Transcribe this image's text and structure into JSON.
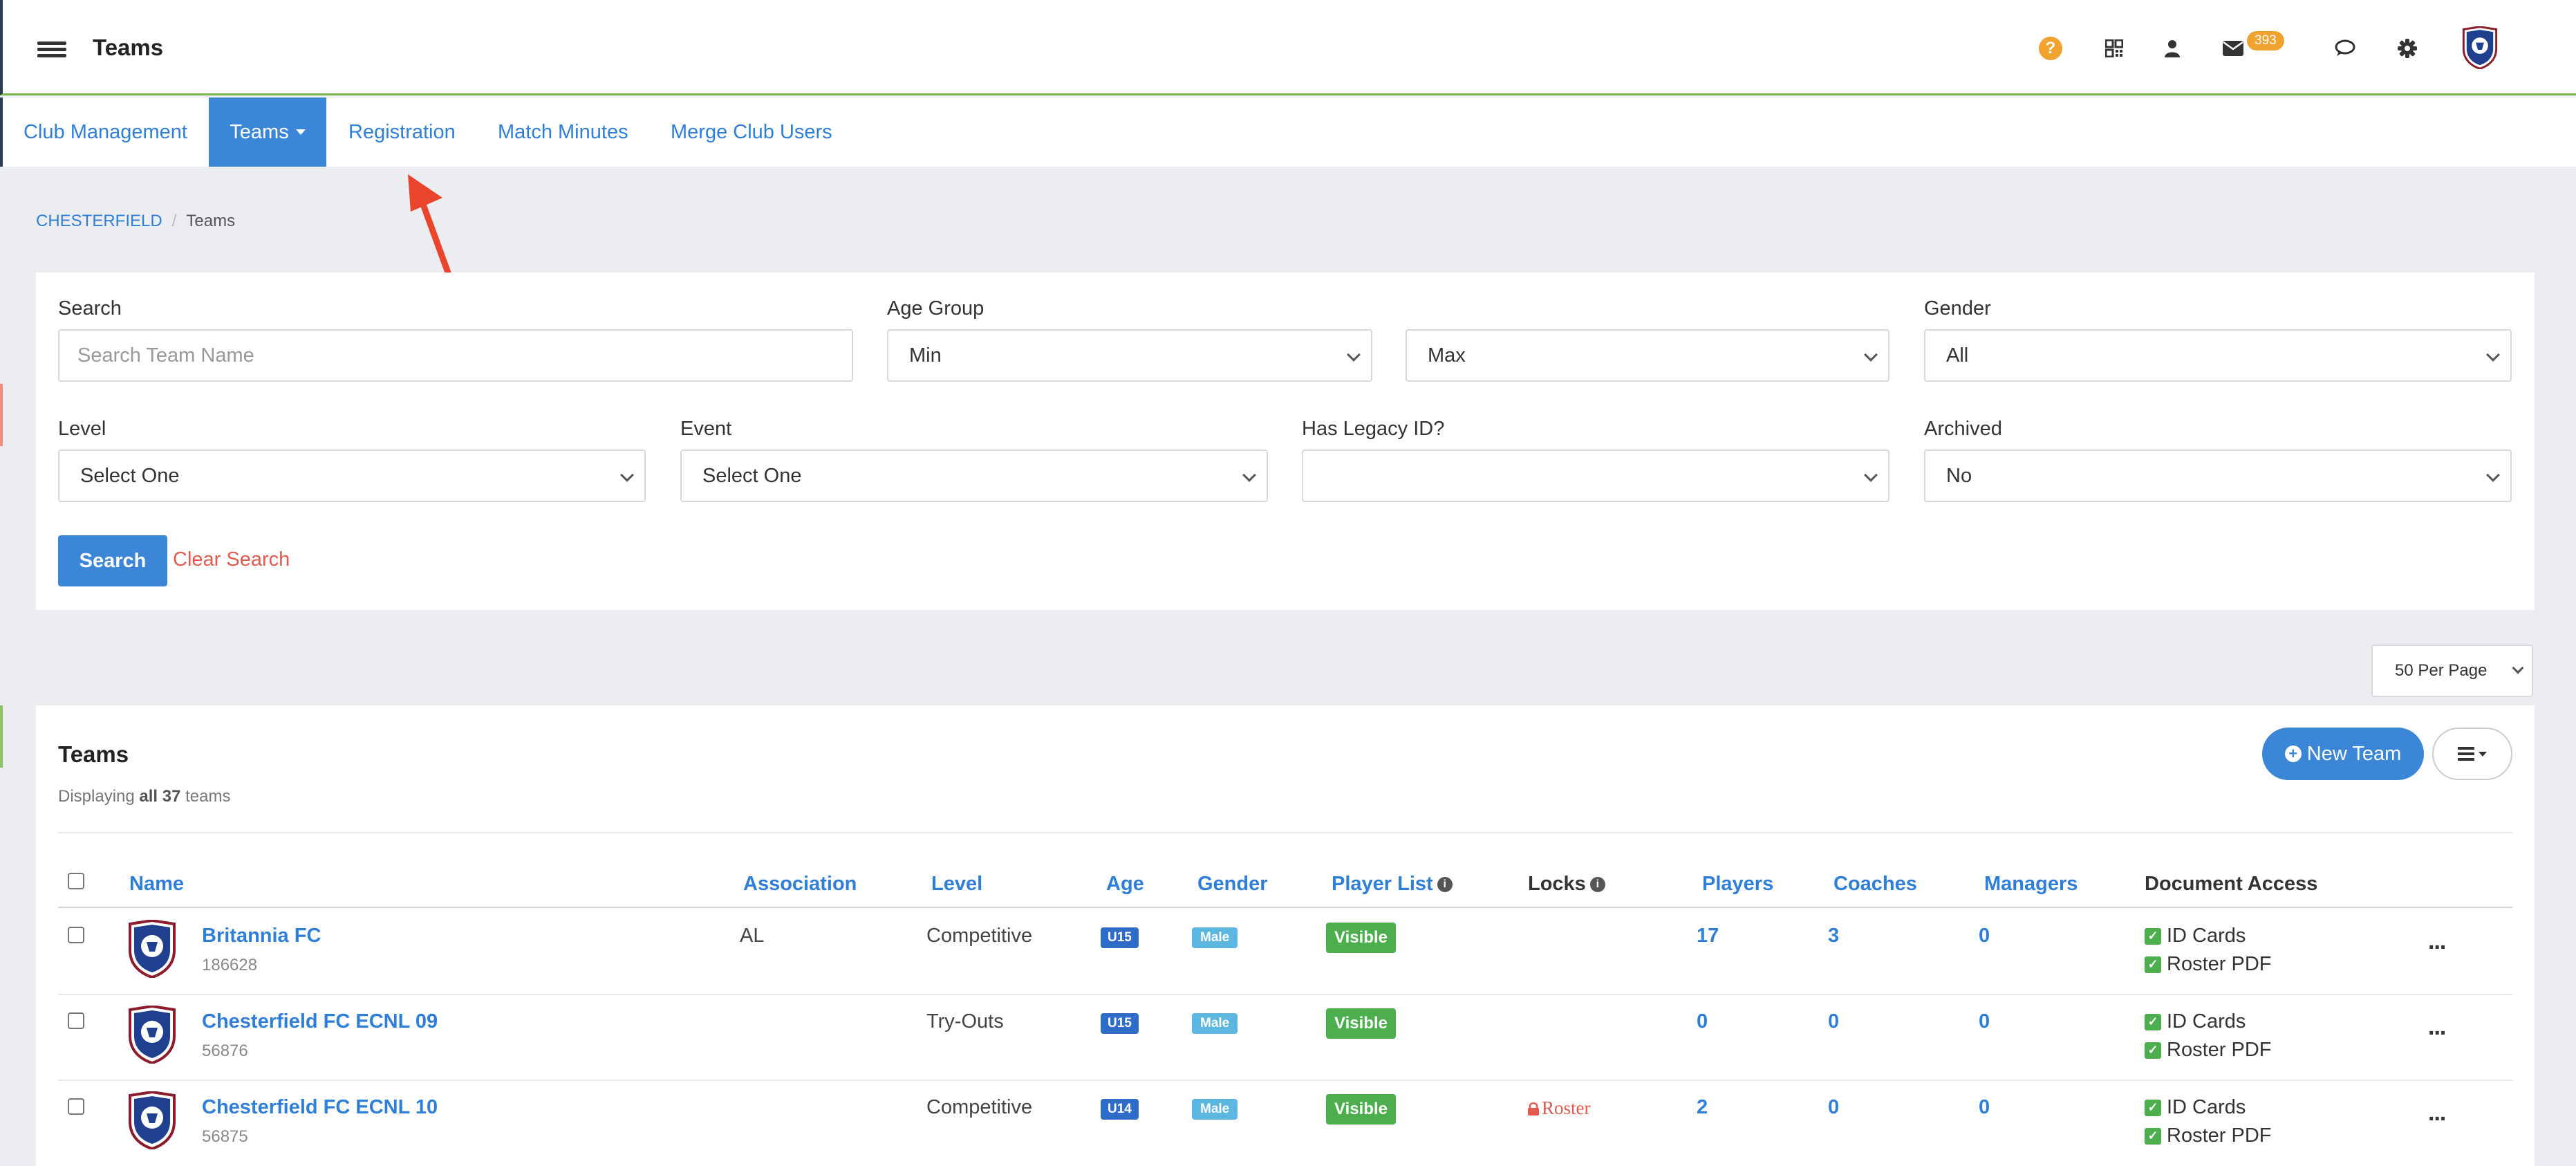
{
  "header": {
    "title": "Teams",
    "mail_count": "393",
    "icons": [
      "menu-icon",
      "help-icon",
      "qr-code-icon",
      "user-icon",
      "mail-icon",
      "chat-icon",
      "gear-icon",
      "club-crest-icon"
    ],
    "accent_color": "#7ab648"
  },
  "nav": {
    "items": [
      {
        "label": "Club Management"
      },
      {
        "label": "Teams",
        "active": true
      },
      {
        "label": "Registration"
      },
      {
        "label": "Match Minutes"
      },
      {
        "label": "Merge Club Users"
      }
    ]
  },
  "breadcrumb": {
    "club": "CHESTERFIELD",
    "current": "Teams"
  },
  "filters": {
    "search_label": "Search",
    "search_placeholder": "Search Team Name",
    "age_group_label": "Age Group",
    "age_min": "Min",
    "age_max": "Max",
    "gender_label": "Gender",
    "gender_value": "All",
    "level_label": "Level",
    "level_value": "Select One",
    "event_label": "Event",
    "event_value": "Select One",
    "legacy_label": "Has Legacy ID?",
    "legacy_value": "",
    "archived_label": "Archived",
    "archived_value": "No",
    "search_button": "Search",
    "clear_button": "Clear Search"
  },
  "pagination": {
    "per_page": "50 Per Page"
  },
  "teams_card": {
    "title": "Teams",
    "subtitle_prefix": "Displaying",
    "subtitle_bold": "all 37",
    "subtitle_suffix": "teams",
    "new_team_button": "New Team"
  },
  "table": {
    "headers": {
      "name": "Name",
      "association": "Association",
      "level": "Level",
      "age": "Age",
      "gender": "Gender",
      "player_list": "Player List",
      "locks": "Locks",
      "players": "Players",
      "coaches": "Coaches",
      "managers": "Managers",
      "document_access": "Document Access"
    },
    "rows": [
      {
        "name": "Britannia FC",
        "id": "186628",
        "association": "AL",
        "level": "Competitive",
        "age": "U15",
        "gender": "Male",
        "player_list": "Visible",
        "lock": "",
        "players": "17",
        "coaches": "3",
        "managers": "0",
        "doc1": "ID Cards",
        "doc2": "Roster PDF"
      },
      {
        "name": "Chesterfield FC ECNL 09",
        "id": "56876",
        "association": "",
        "level": "Try-Outs",
        "age": "U15",
        "gender": "Male",
        "player_list": "Visible",
        "lock": "",
        "players": "0",
        "coaches": "0",
        "managers": "0",
        "doc1": "ID Cards",
        "doc2": "Roster PDF"
      },
      {
        "name": "Chesterfield FC ECNL 10",
        "id": "56875",
        "association": "",
        "level": "Competitive",
        "age": "U14",
        "gender": "Male",
        "player_list": "Visible",
        "lock": "Roster",
        "players": "2",
        "coaches": "0",
        "managers": "0",
        "doc1": "ID Cards",
        "doc2": "Roster PDF"
      }
    ],
    "row_menu_glyph": "..."
  },
  "colors": {
    "primary": "#3c86d8",
    "link": "#2f7ed8",
    "danger": "#e05a4f",
    "success": "#4cae4c",
    "warning": "#f0a32f"
  }
}
